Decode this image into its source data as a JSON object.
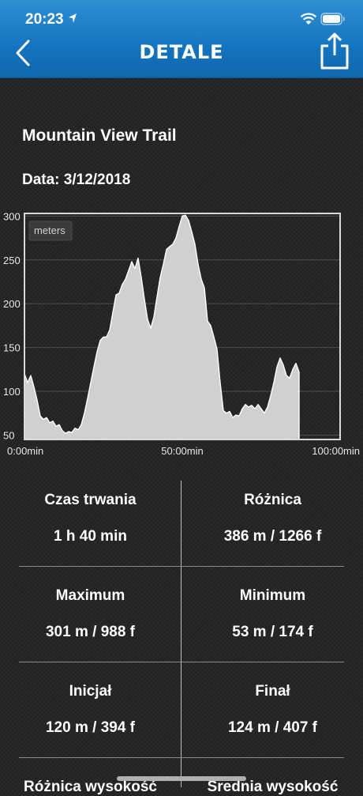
{
  "status_bar": {
    "time": "20:23"
  },
  "nav": {
    "title": "DETALE"
  },
  "trail": {
    "name": "Mountain View Trail",
    "date": "Data: 3/12/2018"
  },
  "chart_data": {
    "type": "area",
    "legend_label": "meters",
    "x_tick_labels": [
      "0:00min",
      "50:00min",
      "100:00min"
    ],
    "y_tick_labels": [
      "300",
      "250",
      "200",
      "150",
      "100",
      "50"
    ],
    "xlim": [
      0,
      100
    ],
    "ylim": [
      45,
      303
    ],
    "grid": true,
    "x": [
      0,
      1,
      2,
      3,
      4,
      5,
      6,
      7,
      8,
      9,
      10,
      11,
      12,
      13,
      14,
      15,
      16,
      17,
      18,
      19,
      20,
      21,
      22,
      23,
      24,
      25,
      26,
      27,
      28,
      29,
      30,
      31,
      32,
      33,
      34,
      35,
      36,
      37,
      38,
      39,
      40,
      41,
      42,
      43,
      44,
      45,
      46,
      47,
      48,
      49,
      50,
      51,
      52,
      53,
      54,
      55,
      56,
      57,
      58,
      59,
      60,
      61,
      62,
      63,
      64,
      65,
      66,
      67,
      68,
      69,
      70,
      71,
      72,
      73,
      74,
      75,
      76,
      77,
      78,
      79,
      80,
      81,
      82,
      83,
      84,
      85,
      86,
      87,
      88,
      89,
      90,
      91,
      92,
      93,
      94,
      95,
      96,
      97,
      98,
      99,
      100
    ],
    "y": [
      120,
      110,
      118,
      105,
      90,
      72,
      68,
      70,
      64,
      66,
      60,
      62,
      55,
      52,
      54,
      53,
      58,
      56,
      62,
      75,
      92,
      110,
      128,
      145,
      158,
      162,
      162,
      170,
      190,
      210,
      212,
      222,
      228,
      238,
      248,
      240,
      252,
      230,
      205,
      182,
      172,
      185,
      208,
      230,
      245,
      262,
      265,
      268,
      275,
      288,
      300,
      301,
      295,
      282,
      268,
      245,
      228,
      218,
      180,
      175,
      162,
      148,
      110,
      78,
      75,
      77,
      70,
      73,
      72,
      80,
      85,
      82,
      84,
      80,
      85,
      80,
      75,
      82,
      95,
      110,
      128,
      138,
      130,
      118,
      115,
      125,
      132,
      122
    ]
  },
  "stats": [
    {
      "label": "Czas trwania",
      "value": "1 h 40 min"
    },
    {
      "label": "Różnica",
      "value": "386 m / 1266 f"
    },
    {
      "label": "Maximum",
      "value": "301 m / 988 f"
    },
    {
      "label": "Minimum",
      "value": "53 m / 174 f"
    },
    {
      "label": "Inicjał",
      "value": "120 m / 394 f"
    },
    {
      "label": "Finał",
      "value": "124 m / 407 f"
    },
    {
      "label": "Różnica wysokość",
      "value": ""
    },
    {
      "label": "Średnia wysokość",
      "value": ""
    }
  ]
}
